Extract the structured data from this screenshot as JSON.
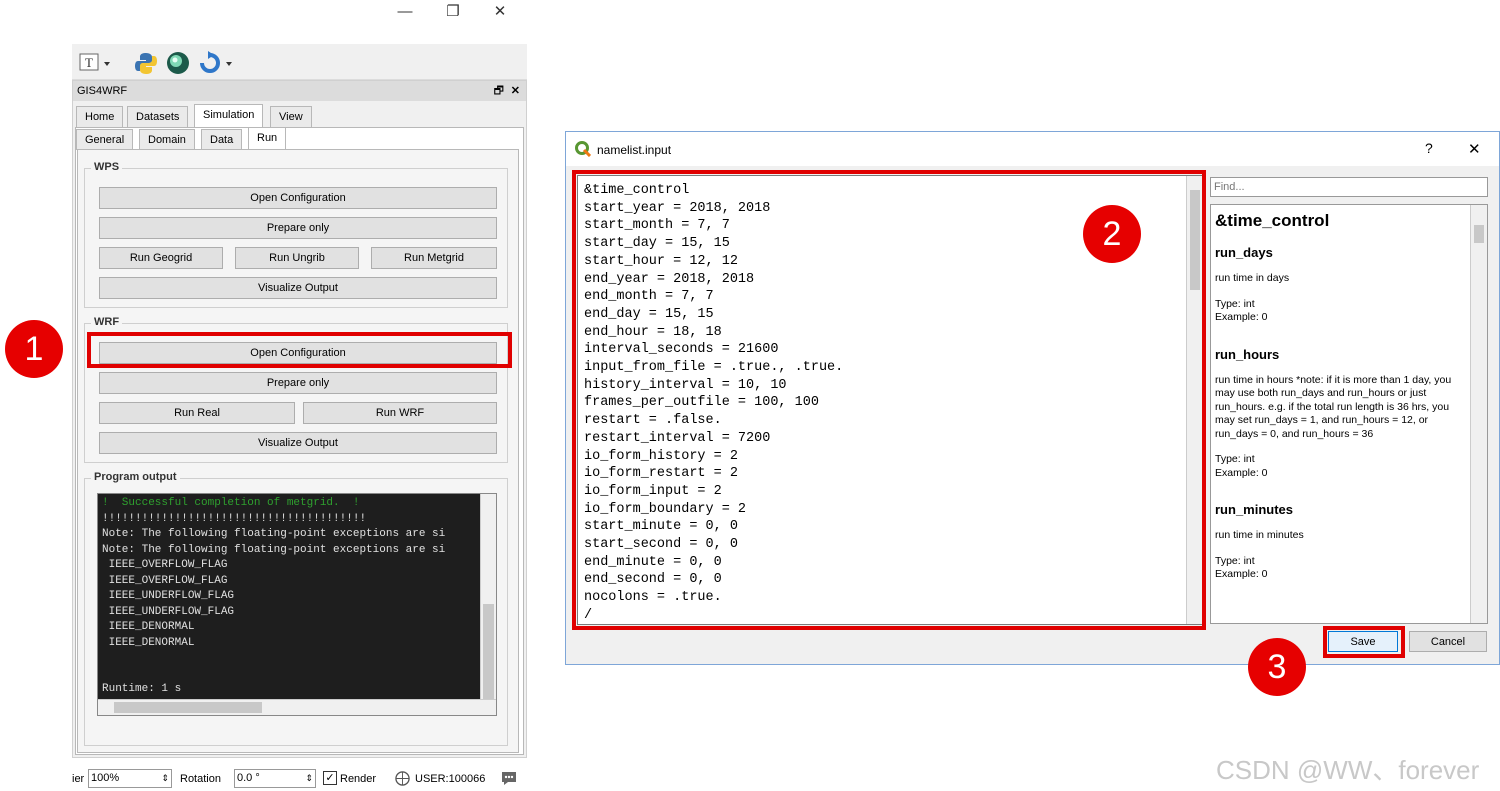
{
  "window_controls": {
    "minimize": "—",
    "restore": "❐",
    "close": "✕"
  },
  "panel": {
    "title": "GIS4WRF",
    "close_glyph": "✕",
    "float_glyph": "🗗",
    "main_tabs": [
      "Home",
      "Datasets",
      "Simulation",
      "View"
    ],
    "sub_tabs": [
      "General",
      "Domain",
      "Data",
      "Run"
    ],
    "wps": {
      "title": "WPS",
      "open_configuration": "Open Configuration",
      "prepare_only": "Prepare only",
      "run_geogrid": "Run Geogrid",
      "run_ungrib": "Run Ungrib",
      "run_metgrid": "Run Metgrid",
      "visualize_output": "Visualize Output"
    },
    "wrf": {
      "title": "WRF",
      "open_configuration": "Open Configuration",
      "prepare_only": "Prepare only",
      "run_real": "Run Real",
      "run_wrf": "Run WRF",
      "visualize_output": "Visualize Output"
    },
    "program_output": {
      "title": "Program output",
      "lines": [
        "!  Successful completion of metgrid.  !",
        "!!!!!!!!!!!!!!!!!!!!!!!!!!!!!!!!!!!!!!!!",
        "Note: The following floating-point exceptions are si",
        "Note: The following floating-point exceptions are si",
        " IEEE_OVERFLOW_FLAG",
        " IEEE_OVERFLOW_FLAG",
        " IEEE_UNDERFLOW_FLAG",
        " IEEE_UNDERFLOW_FLAG",
        " IEEE_DENORMAL",
        " IEEE_DENORMAL",
        "",
        "",
        "Runtime: 1 s"
      ]
    }
  },
  "statusbar": {
    "magnifier_label": "ier",
    "magnifier_value": "100%",
    "rotation_label": "Rotation",
    "rotation_value": "0.0 °",
    "render_label": "Render",
    "user_label": "USER:100066"
  },
  "callouts": [
    "1",
    "2",
    "3"
  ],
  "dialog": {
    "title": "namelist.input",
    "help_glyph": "?",
    "close_glyph": "✕",
    "find_placeholder": "Find...",
    "code_lines": [
      "&time_control",
      "start_year = 2018, 2018",
      "start_month = 7, 7",
      "start_day = 15, 15",
      "start_hour = 12, 12",
      "end_year = 2018, 2018",
      "end_month = 7, 7",
      "end_day = 15, 15",
      "end_hour = 18, 18",
      "interval_seconds = 21600",
      "input_from_file = .true., .true.",
      "history_interval = 10, 10",
      "frames_per_outfile = 100, 100",
      "restart = .false.",
      "restart_interval = 7200",
      "io_form_history = 2",
      "io_form_restart = 2",
      "io_form_input = 2",
      "io_form_boundary = 2",
      "start_minute = 0, 0",
      "start_second = 0, 0",
      "end_minute = 0, 0",
      "end_second = 0, 0",
      "nocolons = .true.",
      "/"
    ],
    "help": {
      "section": "&time_control",
      "entries": [
        {
          "key": "run_days",
          "desc": "run time in days",
          "type": "Type: int",
          "example": "Example: 0"
        },
        {
          "key": "run_hours",
          "desc": "run time in hours *note: if it is more than 1 day, you may use both run_days and run_hours or just run_hours. e.g. if the total run length is 36 hrs, you may set run_days = 1, and run_hours = 12, or run_days = 0, and run_hours = 36",
          "type": "Type: int",
          "example": "Example: 0"
        },
        {
          "key": "run_minutes",
          "desc": "run time in minutes",
          "type": "Type: int",
          "example": "Example: 0"
        }
      ]
    },
    "save_label": "Save",
    "cancel_label": "Cancel"
  },
  "watermark": "CSDN @WW、forever"
}
